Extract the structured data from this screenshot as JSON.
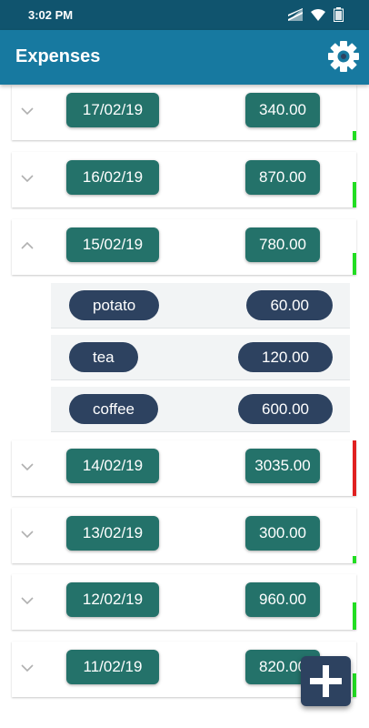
{
  "status_bar": {
    "time": "3:02 PM",
    "icons": [
      "signal-icon",
      "wifi-icon",
      "battery-icon"
    ]
  },
  "app_bar": {
    "title": "Expenses",
    "settings_icon": "gear-icon"
  },
  "colors": {
    "status_bar": "#10546e",
    "app_bar": "#1779a0",
    "pill": "#24726a",
    "item_pill": "#2d4260",
    "indicator_green": "#22dd22",
    "indicator_red": "#e02020"
  },
  "expenses": [
    {
      "date": "17/02/19",
      "amount": "340.00",
      "expanded": false
    },
    {
      "date": "16/02/19",
      "amount": "870.00",
      "expanded": false
    },
    {
      "date": "15/02/19",
      "amount": "780.00",
      "expanded": true,
      "items": [
        {
          "name": "potato",
          "amount": "60.00"
        },
        {
          "name": "tea",
          "amount": "120.00"
        },
        {
          "name": "coffee",
          "amount": "600.00"
        }
      ]
    },
    {
      "date": "14/02/19",
      "amount": "3035.00",
      "expanded": false
    },
    {
      "date": "13/02/19",
      "amount": "300.00",
      "expanded": false
    },
    {
      "date": "12/02/19",
      "amount": "960.00",
      "expanded": false
    },
    {
      "date": "11/02/19",
      "amount": "820.00",
      "expanded": false
    }
  ],
  "fab": {
    "icon": "plus-icon"
  }
}
